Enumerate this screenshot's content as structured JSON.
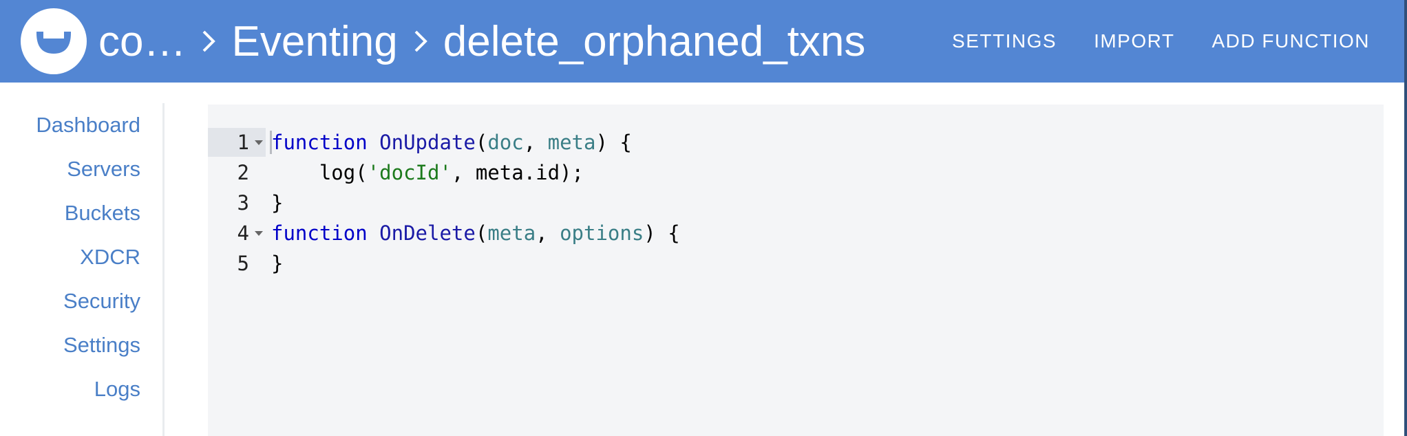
{
  "header": {
    "breadcrumb": [
      "co…",
      "Eventing",
      "delete_orphaned_txns"
    ],
    "actions": [
      "SETTINGS",
      "IMPORT",
      "ADD FUNCTION"
    ],
    "background": "#5386d3"
  },
  "sidebar": {
    "items": [
      {
        "label": "Dashboard"
      },
      {
        "label": "Servers"
      },
      {
        "label": "Buckets"
      },
      {
        "label": "XDCR"
      },
      {
        "label": "Security"
      },
      {
        "label": "Settings"
      },
      {
        "label": "Logs"
      }
    ],
    "link_color": "#4a7fc7"
  },
  "editor": {
    "active_line": 1,
    "lines": [
      {
        "number": "1",
        "foldable": true,
        "tokens": [
          {
            "t": "function",
            "c": "kw"
          },
          {
            "t": " ",
            "c": "plain"
          },
          {
            "t": "OnUpdate",
            "c": "fn"
          },
          {
            "t": "(",
            "c": "plain"
          },
          {
            "t": "doc",
            "c": "param"
          },
          {
            "t": ", ",
            "c": "plain"
          },
          {
            "t": "meta",
            "c": "param"
          },
          {
            "t": ") {",
            "c": "plain"
          }
        ]
      },
      {
        "number": "2",
        "foldable": false,
        "tokens": [
          {
            "t": "    log(",
            "c": "plain"
          },
          {
            "t": "'docId'",
            "c": "str"
          },
          {
            "t": ", meta.id);",
            "c": "plain"
          }
        ]
      },
      {
        "number": "3",
        "foldable": false,
        "tokens": [
          {
            "t": "}",
            "c": "plain"
          }
        ]
      },
      {
        "number": "4",
        "foldable": true,
        "tokens": [
          {
            "t": "function",
            "c": "kw"
          },
          {
            "t": " ",
            "c": "plain"
          },
          {
            "t": "OnDelete",
            "c": "fn"
          },
          {
            "t": "(",
            "c": "plain"
          },
          {
            "t": "meta",
            "c": "param"
          },
          {
            "t": ", ",
            "c": "plain"
          },
          {
            "t": "options",
            "c": "param"
          },
          {
            "t": ") {",
            "c": "plain"
          }
        ]
      },
      {
        "number": "5",
        "foldable": false,
        "tokens": [
          {
            "t": "}",
            "c": "plain"
          }
        ]
      }
    ]
  }
}
